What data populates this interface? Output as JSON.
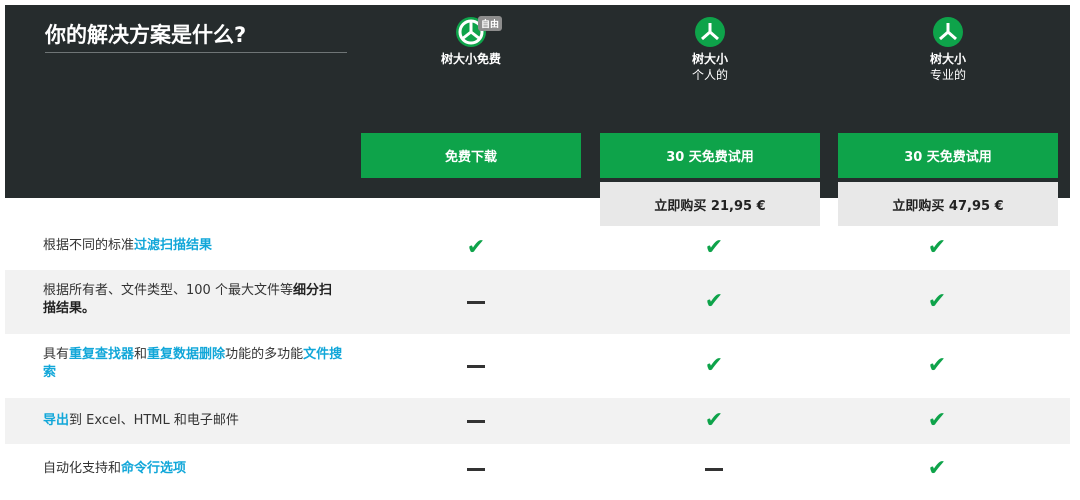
{
  "header": {
    "title": "你的解决方案是什么?"
  },
  "plans": [
    {
      "name": "树大小免费",
      "subtitle": "",
      "badge": "自由",
      "primary_button": "免费下载",
      "buy_button": ""
    },
    {
      "name": "树大小",
      "subtitle": "个人的",
      "badge": "",
      "primary_button": "30 天免费试用",
      "buy_button": "立即购买 21,95 €"
    },
    {
      "name": "树大小",
      "subtitle": "专业的",
      "badge": "",
      "primary_button": "30 天免费试用",
      "buy_button": "立即购买 47,95 €"
    }
  ],
  "features": [
    {
      "parts": [
        {
          "text": "根据不同的标准",
          "style": "normal"
        },
        {
          "text": "过滤扫描结果",
          "style": "highlight"
        }
      ],
      "availability": [
        true,
        true,
        true
      ]
    },
    {
      "parts": [
        {
          "text": "根据所有者、文件类型、100 个最大文件等",
          "style": "normal"
        },
        {
          "text": "细分扫描结果。",
          "style": "bold"
        }
      ],
      "availability": [
        false,
        true,
        true
      ]
    },
    {
      "parts": [
        {
          "text": "具有",
          "style": "normal"
        },
        {
          "text": "重复查找器",
          "style": "highlight"
        },
        {
          "text": "和",
          "style": "normal"
        },
        {
          "text": "重复数据删除",
          "style": "highlight"
        },
        {
          "text": "功能的多功能",
          "style": "normal"
        },
        {
          "text": "文件搜索",
          "style": "highlight"
        }
      ],
      "availability": [
        false,
        true,
        true
      ]
    },
    {
      "parts": [
        {
          "text": "导出",
          "style": "highlight"
        },
        {
          "text": "到 Excel、HTML 和电子邮件",
          "style": "normal"
        }
      ],
      "availability": [
        false,
        true,
        true
      ]
    },
    {
      "parts": [
        {
          "text": "自动化支持和",
          "style": "normal"
        },
        {
          "text": "命令行选项",
          "style": "highlight"
        }
      ],
      "availability": [
        false,
        false,
        true
      ]
    }
  ],
  "colors": {
    "header_bg": "#262c2d",
    "brand_green": "#0ea34a",
    "highlight_blue": "#12a7d9",
    "buy_bg": "#e8e8e8",
    "row_shade": "#f2f2f2"
  },
  "icons": {
    "available": "check-icon",
    "unavailable": "dash-icon",
    "logo": "treesize-logo-icon"
  }
}
